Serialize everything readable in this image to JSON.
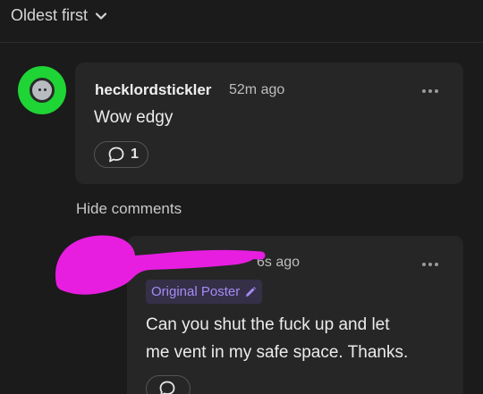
{
  "sort": {
    "label": "Oldest first"
  },
  "comments": [
    {
      "username": "hecklordstickler",
      "time": "52m ago",
      "text": "Wow edgy",
      "reply_count": "1",
      "avatar_color": "#1fd435"
    },
    {
      "time": "6s ago",
      "badge": "Original Poster",
      "text_line1": "Can you shut the fuck up and let",
      "text_line2": "me vent in my safe space. Thanks."
    }
  ],
  "thread": {
    "hide_label": "Hide comments"
  },
  "colors": {
    "accent": "#a48cf5",
    "scribble": "#e71ee0",
    "background": "#1b1b1b",
    "card": "#262626"
  }
}
